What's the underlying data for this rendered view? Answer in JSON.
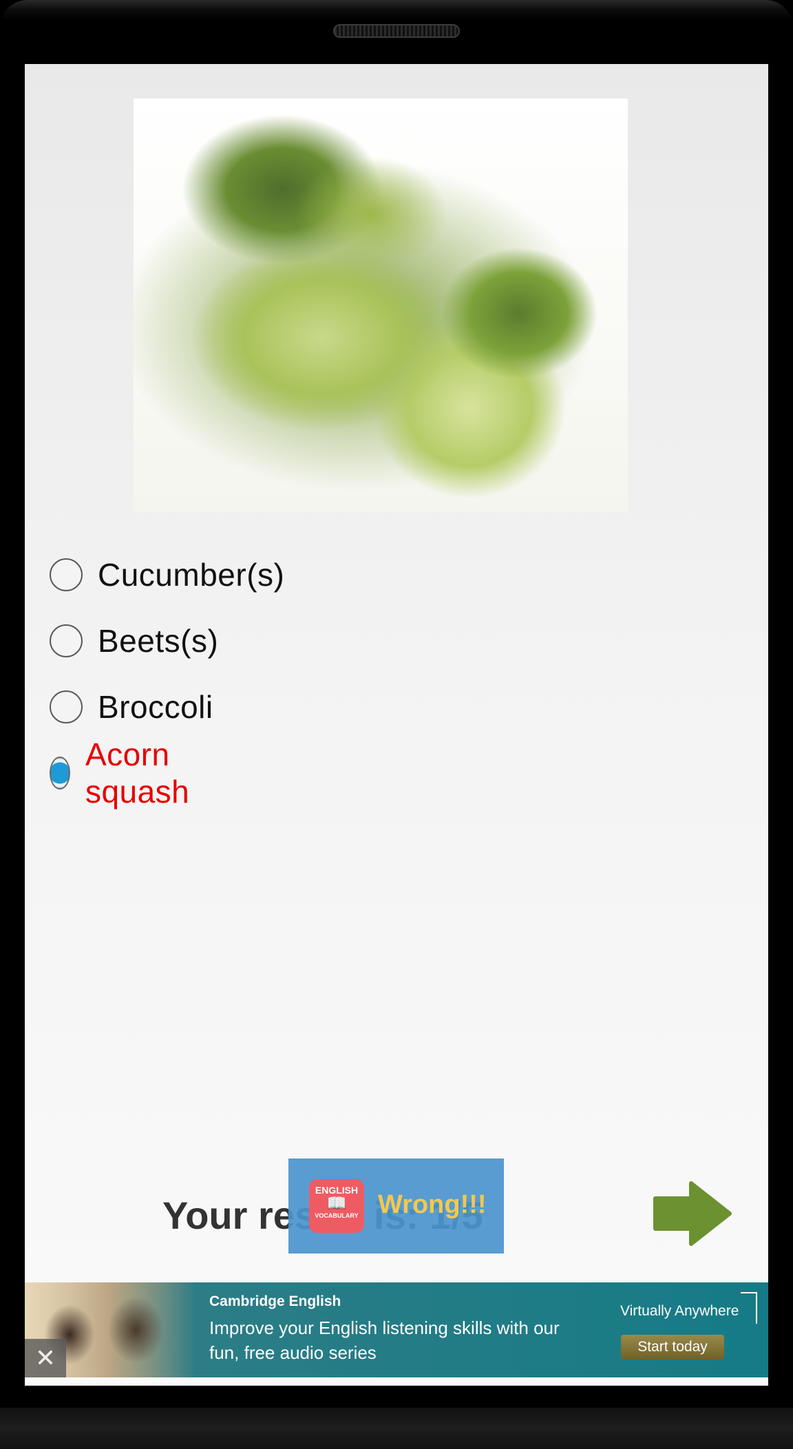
{
  "quiz": {
    "image_icon": "broccoli-photo",
    "options": [
      {
        "label": "Cucumber(s)",
        "selected": false,
        "wrong": false
      },
      {
        "label": "Beets(s)",
        "selected": false,
        "wrong": false
      },
      {
        "label": "Broccoli",
        "selected": false,
        "wrong": false
      },
      {
        "label": "Acorn squash",
        "selected": true,
        "wrong": true
      }
    ],
    "result_text": "Your result is: 1/5",
    "next_icon": "arrow-right-icon"
  },
  "toast": {
    "logo_line1": "ENGLISH",
    "logo_line2": "VOCABULARY",
    "message": "Wrong!!!"
  },
  "ad": {
    "brand": "Cambridge English",
    "message": "Improve your English listening skills with our fun, free audio series",
    "tagline": "Virtually Anywhere",
    "cta": "Start today",
    "close_icon": "close-icon"
  },
  "colors": {
    "wrong": "#e60000",
    "arrow": "#6b9130",
    "toast_bg": "#4a94cd",
    "toast_text": "#f2c94c",
    "ad_bg": "#157b86"
  }
}
